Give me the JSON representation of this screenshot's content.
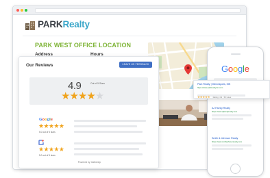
{
  "brand": {
    "name_part1": "PARK",
    "name_part2": "Realty",
    "accent_color": "#3aa6c9",
    "logo_icon": "building-icon"
  },
  "office": {
    "title": "PARK WEST OFFICE LOCATION",
    "title_color": "#7fb437",
    "address_label": "Address",
    "hours_label": "Hours"
  },
  "reviews": {
    "title": "Our Reviews",
    "feedback_button": "LEAVE US FEEDBACK",
    "average": "4.9",
    "out_of": "Out of 5 Stars",
    "overall_stars": 4.9,
    "sources": [
      {
        "name": "Google",
        "icon": "google-logo",
        "stars": 5,
        "avg_text": "5.0 out of 5 stars"
      },
      {
        "name": "",
        "icon": "review-site-logo",
        "stars": 5,
        "avg_text": "5.0 out of 5 stars"
      }
    ],
    "powered_by": "Powered by GatherUp",
    "star_color": "#f0a31c",
    "button_color": "#3f6fc4"
  },
  "phone": {
    "search_logo": "Google",
    "results": [
      {
        "title": "Park Realty | Minneapolis, MN",
        "url": "https://www.parkrealtymn.com",
        "rating": "Rating: 4.9 · 56 votes",
        "stars": 5
      },
      {
        "title": "AJ Family Realty",
        "url": "https://www.ajfamilyrealty.com"
      },
      {
        "title": "Smith & Johnson Realty",
        "url": "https://www.smithjohnsonrealty.com"
      }
    ]
  }
}
